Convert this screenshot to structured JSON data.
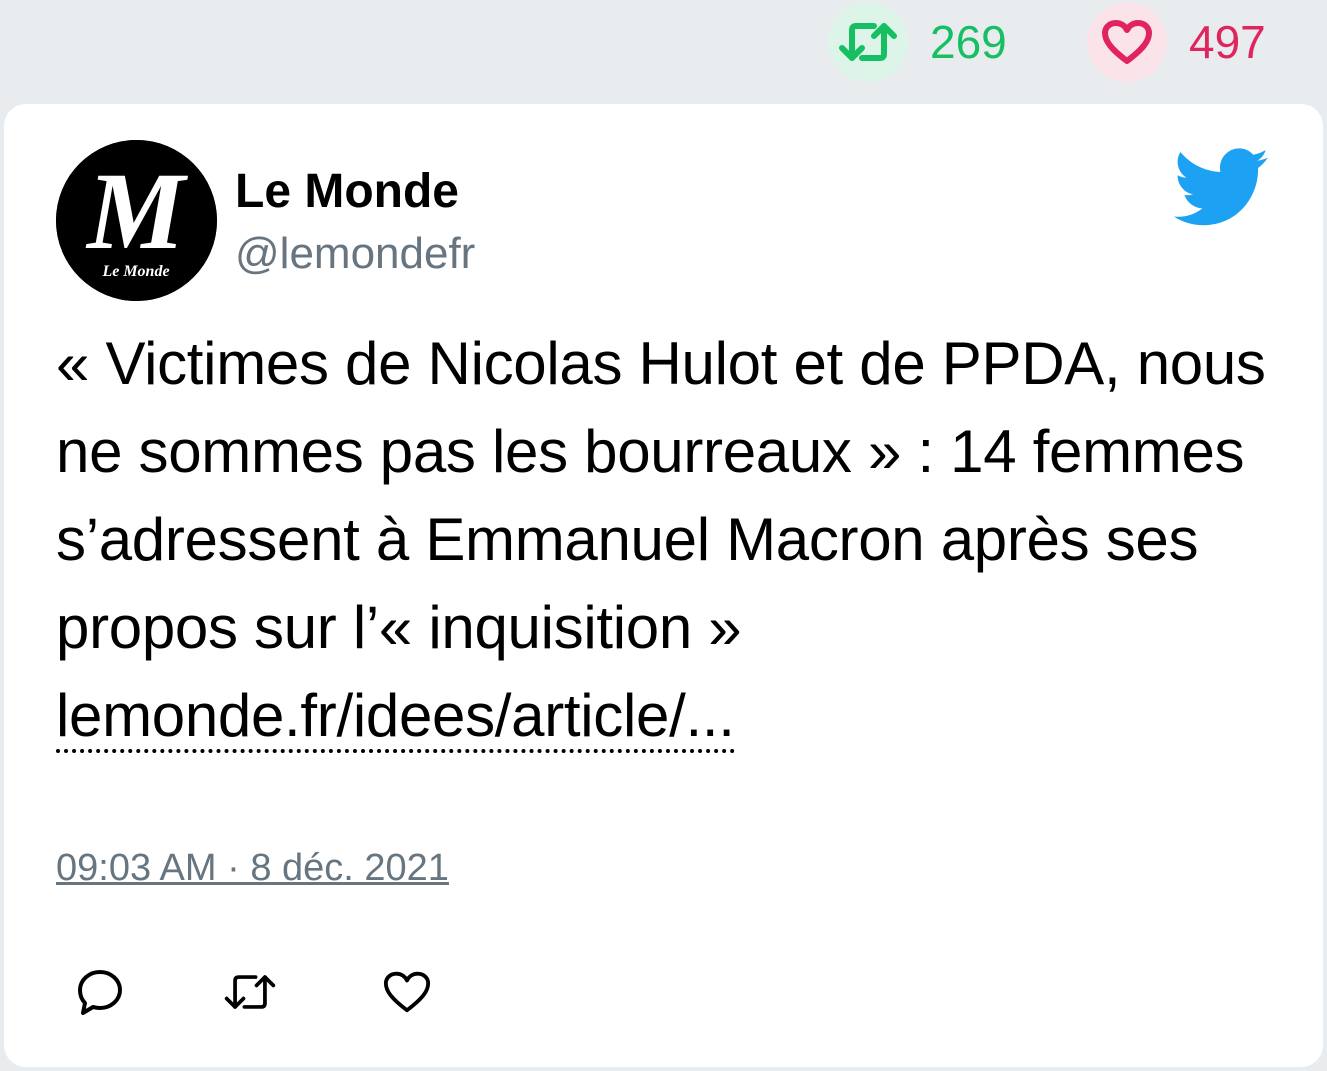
{
  "stats": {
    "retweets": "269",
    "likes": "497",
    "retweet_color": "#17bf63",
    "like_color": "#e0245e"
  },
  "tweet": {
    "author_name": "Le Monde",
    "author_handle": "@lemondefr",
    "avatar_icon": "le-monde-logo",
    "text": "« Victimes de Nicolas Hulot et de PPDA, nous ne sommes pas les bourreaux » : 14 femmes s’adressent à Emmanuel Macron après ses propos sur l’« inquisition » ",
    "link_text": "lemonde.fr/idees/article/...",
    "timestamp": "09:03 AM · 8 déc. 2021"
  },
  "actions": {
    "reply_icon": "reply-icon",
    "retweet_icon": "retweet-icon",
    "like_icon": "heart-icon"
  },
  "brand_icon": "twitter-bird-icon",
  "brand_color": "#1da1f2"
}
